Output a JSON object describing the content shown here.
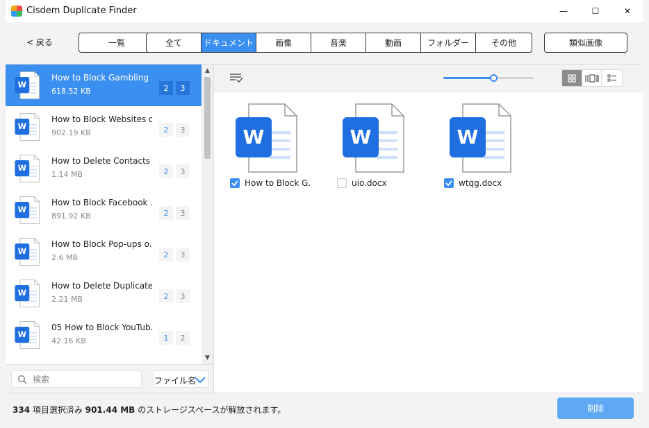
{
  "window": {
    "title": "Cisdem Duplicate Finder",
    "minimize_glyph": "—",
    "maximize_glyph": "☐",
    "close_glyph": "✕"
  },
  "toolbar": {
    "back_label": "< 戻る",
    "overview_label": "一覧",
    "similar_images_label": "類似画像",
    "categories": [
      "全て",
      "ドキュメント",
      "画像",
      "音楽",
      "動画",
      "フォルダー",
      "その他"
    ],
    "active_category": "ドキュメント"
  },
  "list": {
    "items": [
      {
        "name": "How to Block Gambling ...",
        "size": "618.52 KB",
        "selected_count": "2",
        "total_count": "3",
        "selected": true
      },
      {
        "name": "How to Block Websites o...",
        "size": "902.19 KB",
        "selected_count": "2",
        "total_count": "3",
        "selected": false
      },
      {
        "name": "How to Delete Contacts f...",
        "size": "1.14 MB",
        "selected_count": "2",
        "total_count": "3",
        "selected": false
      },
      {
        "name": "How to Block Facebook ...",
        "size": "891.92 KB",
        "selected_count": "2",
        "total_count": "3",
        "selected": false
      },
      {
        "name": "How to Block Pop-ups o...",
        "size": "2.6 MB",
        "selected_count": "2",
        "total_count": "3",
        "selected": false
      },
      {
        "name": "How to Delete Duplicate ...",
        "size": "2.21 MB",
        "selected_count": "2",
        "total_count": "3",
        "selected": false
      },
      {
        "name": "05 How to Block YouTub...",
        "size": "42.16 KB",
        "selected_count": "1",
        "total_count": "2",
        "selected": false
      }
    ],
    "search_placeholder": "検索",
    "sort_label": "ファイル名"
  },
  "preview": {
    "thumbnail_size": 0.55,
    "files": [
      {
        "name": "How to Block G...",
        "checked": true
      },
      {
        "name": "uio.docx",
        "checked": false
      },
      {
        "name": "wtqg.docx",
        "checked": true
      }
    ]
  },
  "status": {
    "count": "334",
    "selected_text": "項目選択済み",
    "size": "901.44 MB",
    "suffix": "のストレージスペースが解放されます。",
    "delete_label": "削除"
  },
  "colors": {
    "accent": "#3b8ff0",
    "word_blue": "#1f6fe0",
    "delete_button": "#5ea8f4"
  }
}
